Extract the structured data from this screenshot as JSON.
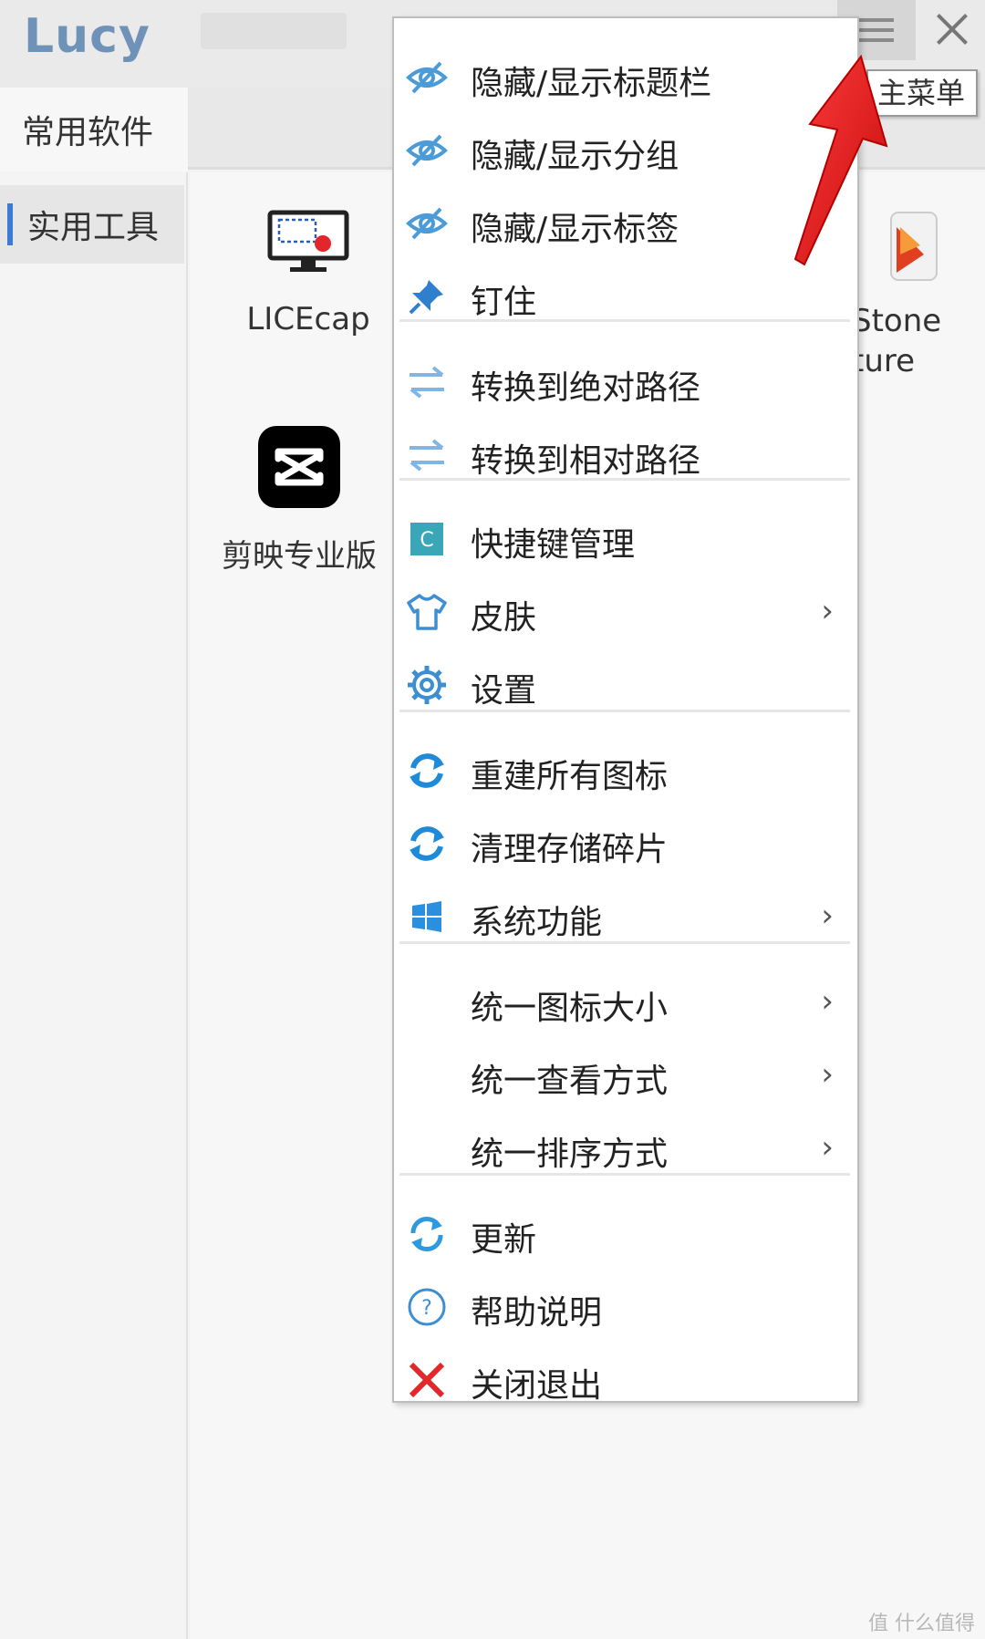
{
  "app": {
    "title": "Lucy"
  },
  "tabs": [
    {
      "label": "常用软件"
    }
  ],
  "sidebar": {
    "items": [
      {
        "label": "实用工具"
      }
    ]
  },
  "apps": [
    {
      "label": "LICEcap"
    },
    {
      "label": "剪映专业版"
    },
    {
      "label_line1": "Stone",
      "label_line2": "ture"
    }
  ],
  "tooltip": {
    "text": "主菜单"
  },
  "menu": {
    "items": [
      {
        "label": "隐藏/显示标题栏",
        "icon": "eye-icon"
      },
      {
        "label": "隐藏/显示分组",
        "icon": "eye-icon"
      },
      {
        "label": "隐藏/显示标签",
        "icon": "eye-icon"
      },
      {
        "label": "钉住",
        "icon": "pin-icon"
      },
      {
        "label": "转换到绝对路径",
        "icon": "swap-arrows-icon"
      },
      {
        "label": "转换到相对路径",
        "icon": "swap-arrows-icon"
      },
      {
        "label": "快捷键管理",
        "icon": "shortcut-c-icon"
      },
      {
        "label": "皮肤",
        "icon": "shirt-icon",
        "submenu": "›"
      },
      {
        "label": "设置",
        "icon": "gear-icon"
      },
      {
        "label": "重建所有图标",
        "icon": "refresh-icon"
      },
      {
        "label": "清理存储碎片",
        "icon": "refresh-icon"
      },
      {
        "label": "系统功能",
        "icon": "windows-icon",
        "submenu": "›"
      },
      {
        "label": "统一图标大小",
        "submenu": "›"
      },
      {
        "label": "统一查看方式",
        "submenu": "›"
      },
      {
        "label": "统一排序方式",
        "submenu": "›"
      },
      {
        "label": "更新",
        "icon": "update-icon"
      },
      {
        "label": "帮助说明",
        "icon": "help-icon"
      },
      {
        "label": "关闭退出",
        "icon": "exit-x-icon"
      }
    ]
  },
  "watermark": "值 什么值得买",
  "colors": {
    "accent": "#3a7bd5",
    "icon_blue": "#3d8fd1",
    "arrow_red": "#e8191a"
  }
}
